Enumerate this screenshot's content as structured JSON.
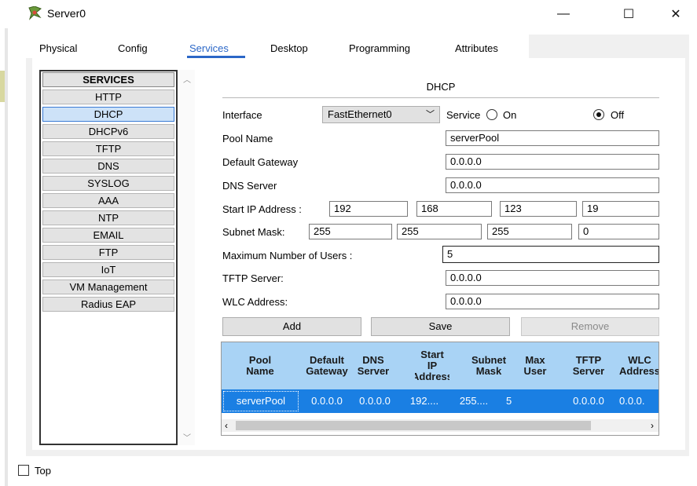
{
  "window": {
    "title": "Server0",
    "minimize_glyph": "—",
    "maximize_glyph": "☐",
    "close_glyph": "✕"
  },
  "tabs": [
    {
      "label": "Physical"
    },
    {
      "label": "Config"
    },
    {
      "label": "Services"
    },
    {
      "label": "Desktop"
    },
    {
      "label": "Programming"
    },
    {
      "label": "Attributes"
    }
  ],
  "services": {
    "header": "SERVICES",
    "items": [
      "HTTP",
      "DHCP",
      "DHCPv6",
      "TFTP",
      "DNS",
      "SYSLOG",
      "AAA",
      "NTP",
      "EMAIL",
      "FTP",
      "IoT",
      "VM Management",
      "Radius EAP"
    ],
    "selected": "DHCP"
  },
  "dhcp": {
    "title": "DHCP",
    "interface_label": "Interface",
    "interface_value": "FastEthernet0",
    "service_label": "Service",
    "on_label": "On",
    "off_label": "Off",
    "service_state": "Off",
    "pool_name_label": "Pool Name",
    "pool_name_value": "serverPool",
    "default_gateway_label": "Default Gateway",
    "default_gateway_value": "0.0.0.0",
    "dns_server_label": "DNS Server",
    "dns_server_value": "0.0.0.0",
    "start_ip_label": "Start IP Address :",
    "start_ip": [
      "192",
      "168",
      "123",
      "19"
    ],
    "subnet_mask_label": "Subnet Mask:",
    "subnet_mask": [
      "255",
      "255",
      "255",
      "0"
    ],
    "max_users_label": "Maximum Number of Users :",
    "max_users_value": "5",
    "tftp_server_label": "TFTP Server:",
    "tftp_server_value": "0.0.0.0",
    "wlc_address_label": "WLC Address:",
    "wlc_address_value": "0.0.0.0",
    "add_label": "Add",
    "save_label": "Save",
    "remove_label": "Remove"
  },
  "pool_table": {
    "headers": [
      "Pool\nName",
      "Default\nGateway",
      "DNS\nServer",
      "Start\nIP\nAddress",
      "Subnet\nMask",
      "Max\nUser",
      "TFTP\nServer",
      "WLC\nAddress"
    ],
    "rows": [
      [
        "serverPool",
        "0.0.0.0",
        "0.0.0.0",
        "192....",
        "255....",
        "5",
        "0.0.0.0",
        "0.0.0."
      ]
    ]
  },
  "bottom": {
    "top_label": "Top"
  },
  "colors": {
    "accent": "#2b67c7",
    "selected_row": "#1a7fe3",
    "table_header": "#a9d3f5"
  }
}
